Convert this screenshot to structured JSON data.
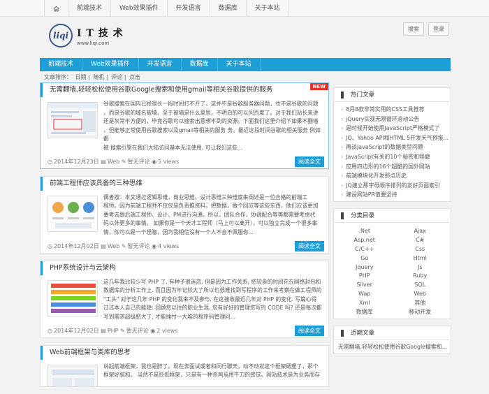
{
  "topnav": {
    "items": [
      "前端技术",
      "Web效果插件",
      "开发语言",
      "数据库",
      "关于本站"
    ]
  },
  "logo": {
    "mark": "liqi",
    "title": "I T 技 术",
    "url": "www.liqi.com"
  },
  "header": {
    "search_label": "搜索",
    "login_label": "登录"
  },
  "nav": {
    "items": [
      "前端技术",
      "Web效果插件",
      "开发语言",
      "数据库",
      "关于本站"
    ]
  },
  "sortbar": {
    "label": "文章排序：",
    "options": [
      "日期",
      "随机",
      "评论",
      "点击"
    ],
    "separator": "|"
  },
  "posts": [
    {
      "title": "无需翻墙,轻轻松松使用谷歌Google搜索和使用gmail等相关谷歌提供的服务",
      "badge": "NEW",
      "lines": [
        "谷歌搜索在国内已经很长一段时间打不开了，这并不是谷歌服务器问题，也不是谷歌的问题",
        "，而是谷歌的域名被墙，至于被墙是什么意思，不明白的可以问百度了。对于我们站长来讲",
        "还是灰常不方便的，毕竟谷歌可以搜索出意想不到的资源。下面我们这里介绍下如果不翻墙",
        "，但能够正常使用谷歌搜索以及gmail等相关的服务 务。最近这段时间谷歌的相关服务 例如都",
        "被 搜索引擎在我们大陆访问基本无法使用, 可让我们这些..."
      ],
      "date": "2014年12月23日",
      "category": "Web",
      "comments": "暂无评论",
      "views": "5 views",
      "read_more": "阅读全文"
    },
    {
      "title": "前端工程师应该具备的三种思维",
      "lines": [
        "偶者按：本文通过逻辑思维，商业思维，设计思维三种维度来阐述是一位合格的前端工",
        "程师。因为前端工程师不仅仅是负责推资料，把数据，做个回应等这些东西，他们应该更加",
        "要考去跟后端工程师、设计、PM进行沟通。所以，团队合作，协调配合等等都需要考虑代",
        "码以外更多的事情。 如果你是一个天才工程师（马上可以离开），可以独立完成一个很多事",
        "情，你可以是一个怪咖，因为我相信没有一个人不会不佩服你..."
      ],
      "date": "2014年12月02日",
      "category": "Web",
      "comments": "暂无评论",
      "views": "4 views",
      "read_more": "阅读全文"
    },
    {
      "title": "PHP系统设计与云架构",
      "lines": [
        "这几年我比较少写 PHP 了, 有种子很迷恋, 但是因为工作关系, 把较多的时间花在网络封包和",
        "数据库的分析工作上. 而且因为年记较大了所以也很难找到写程序的工作来考察在做工程师的",
        "\"工头\" 对于这几年 PHP 的变化我来不及参与. 在这接收最近几年对 PHP 的变化. 写篇心得",
        "过过本人自己的能隐: 回顾您以往的职业生涯, 您有好好的管理您写的 CODE 吗? 还是每次都",
        "写到需求超级肥大了, 才能摊付一大堆的程序码管理问..."
      ],
      "date": "2014年12月02日",
      "category": "PHP",
      "comments": "暂无评论",
      "views": "2 views",
      "read_more": "阅读全文"
    },
    {
      "title": "Web前端框架与类库的思考",
      "lines": [
        "说起前端框架，我也是醉了。现在去面试或者和同行聊天，动不动就这个框架碉堡了，那个",
        "框架好腻和。 当然不是贬低框架，只是有一种杀鸡焉用牛刀的感觉。网站技术是为业务而存"
      ]
    }
  ],
  "sidebar": {
    "hot_title": "热门文章",
    "hot": [
      "8月8款非常实用的CSS工具推荐",
      "jQuery实现无限循环滚动公告",
      "是时候开始使用JavaScript严格模式了",
      "JQ、Yahoo API和HTML 5开发天气预报...",
      "再谈JavaScript的数据类型问题",
      "JavaScript有关的10个秘密和怪癖",
      "应用四边形的16个超酷的国外网站",
      "前端模块化开发那点历史",
      "JQ建立那字母顺序排列的友好页面索引",
      "建设网站PR值要坚持"
    ],
    "cats_title": "分类目录",
    "cats": [
      ".Net",
      "Ajax",
      "Asp.net",
      "C#",
      "C/C++",
      "Css",
      "Go",
      "Html",
      "Jquery",
      "Js",
      "PHP",
      "Ruby",
      "Silver",
      "SQL",
      "Wap",
      "Web",
      "Xml",
      "其他",
      "数据库",
      "移动开发"
    ],
    "recent_title": "近期文章",
    "recent_first": "无需翻墙,轻轻松松使用谷歌Google搜索和..."
  },
  "colors": {
    "accent": "#1d9ed7",
    "badge": "#e8312a"
  }
}
